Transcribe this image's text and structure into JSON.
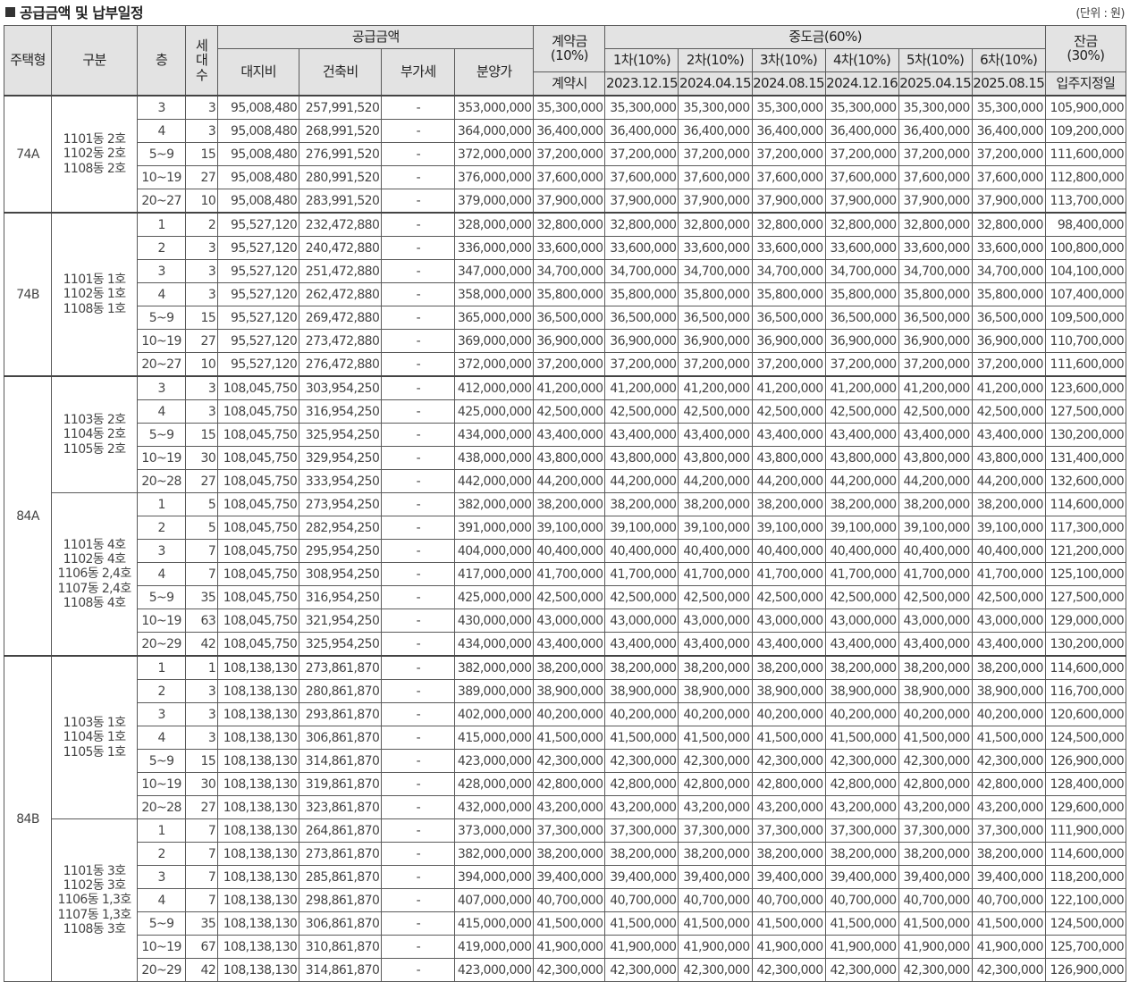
{
  "title": "공급금액 및 납부일정",
  "unit": "(단위 : 원)",
  "headers": {
    "type": "주택형",
    "group": "구분",
    "floor": "층",
    "units": "세\n대\n수",
    "supply": "공급금액",
    "land": "대지비",
    "build": "건축비",
    "vat": "부가세",
    "price": "분양가",
    "deposit": "계약금\n(10%)",
    "deposit_when": "계약시",
    "middle": "중도금(60%)",
    "mid_labels": [
      "1차(10%)",
      "2차(10%)",
      "3차(10%)",
      "4차(10%)",
      "5차(10%)",
      "6차(10%)"
    ],
    "mid_dates": [
      "2023.12.15",
      "2024.04.15",
      "2024.08.15",
      "2024.12.16",
      "2025.04.15",
      "2025.08.15"
    ],
    "balance": "잔금\n(30%)",
    "balance_when": "입주지정일"
  },
  "types": [
    {
      "name": "74A",
      "groups": [
        {
          "label": "1101동 2호\n1102동 2호\n1108동 2호",
          "land": "95,008,480",
          "rows": [
            [
              "3",
              "3",
              "257,991,520",
              "353,000,000",
              "35,300,000",
              "105,900,000"
            ],
            [
              "4",
              "3",
              "268,991,520",
              "364,000,000",
              "36,400,000",
              "109,200,000"
            ],
            [
              "5~9",
              "15",
              "276,991,520",
              "372,000,000",
              "37,200,000",
              "111,600,000"
            ],
            [
              "10~19",
              "27",
              "280,991,520",
              "376,000,000",
              "37,600,000",
              "112,800,000"
            ],
            [
              "20~27",
              "10",
              "283,991,520",
              "379,000,000",
              "37,900,000",
              "113,700,000"
            ]
          ]
        }
      ]
    },
    {
      "name": "74B",
      "groups": [
        {
          "label": "1101동 1호\n1102동 1호\n1108동 1호",
          "land": "95,527,120",
          "rows": [
            [
              "1",
              "2",
              "232,472,880",
              "328,000,000",
              "32,800,000",
              "98,400,000"
            ],
            [
              "2",
              "3",
              "240,472,880",
              "336,000,000",
              "33,600,000",
              "100,800,000"
            ],
            [
              "3",
              "3",
              "251,472,880",
              "347,000,000",
              "34,700,000",
              "104,100,000"
            ],
            [
              "4",
              "3",
              "262,472,880",
              "358,000,000",
              "35,800,000",
              "107,400,000"
            ],
            [
              "5~9",
              "15",
              "269,472,880",
              "365,000,000",
              "36,500,000",
              "109,500,000"
            ],
            [
              "10~19",
              "27",
              "273,472,880",
              "369,000,000",
              "36,900,000",
              "110,700,000"
            ],
            [
              "20~27",
              "10",
              "276,472,880",
              "372,000,000",
              "37,200,000",
              "111,600,000"
            ]
          ]
        }
      ]
    },
    {
      "name": "84A",
      "groups": [
        {
          "label": "1103동 2호\n1104동 2호\n1105동 2호",
          "land": "108,045,750",
          "rows": [
            [
              "3",
              "3",
              "303,954,250",
              "412,000,000",
              "41,200,000",
              "123,600,000"
            ],
            [
              "4",
              "3",
              "316,954,250",
              "425,000,000",
              "42,500,000",
              "127,500,000"
            ],
            [
              "5~9",
              "15",
              "325,954,250",
              "434,000,000",
              "43,400,000",
              "130,200,000"
            ],
            [
              "10~19",
              "30",
              "329,954,250",
              "438,000,000",
              "43,800,000",
              "131,400,000"
            ],
            [
              "20~28",
              "27",
              "333,954,250",
              "442,000,000",
              "44,200,000",
              "132,600,000"
            ]
          ]
        },
        {
          "label": "1101동 4호\n1102동 4호\n1106동 2,4호\n1107동 2,4호\n1108동 4호",
          "land": "108,045,750",
          "rows": [
            [
              "1",
              "5",
              "273,954,250",
              "382,000,000",
              "38,200,000",
              "114,600,000"
            ],
            [
              "2",
              "5",
              "282,954,250",
              "391,000,000",
              "39,100,000",
              "117,300,000"
            ],
            [
              "3",
              "7",
              "295,954,250",
              "404,000,000",
              "40,400,000",
              "121,200,000"
            ],
            [
              "4",
              "7",
              "308,954,250",
              "417,000,000",
              "41,700,000",
              "125,100,000"
            ],
            [
              "5~9",
              "35",
              "316,954,250",
              "425,000,000",
              "42,500,000",
              "127,500,000"
            ],
            [
              "10~19",
              "63",
              "321,954,250",
              "430,000,000",
              "43,000,000",
              "129,000,000"
            ],
            [
              "20~29",
              "42",
              "325,954,250",
              "434,000,000",
              "43,400,000",
              "130,200,000"
            ]
          ]
        }
      ]
    },
    {
      "name": "84B",
      "groups": [
        {
          "label": "1103동 1호\n1104동 1호\n1105동 1호",
          "land": "108,138,130",
          "rows": [
            [
              "1",
              "1",
              "273,861,870",
              "382,000,000",
              "38,200,000",
              "114,600,000"
            ],
            [
              "2",
              "3",
              "280,861,870",
              "389,000,000",
              "38,900,000",
              "116,700,000"
            ],
            [
              "3",
              "3",
              "293,861,870",
              "402,000,000",
              "40,200,000",
              "120,600,000"
            ],
            [
              "4",
              "3",
              "306,861,870",
              "415,000,000",
              "41,500,000",
              "124,500,000"
            ],
            [
              "5~9",
              "15",
              "314,861,870",
              "423,000,000",
              "42,300,000",
              "126,900,000"
            ],
            [
              "10~19",
              "30",
              "319,861,870",
              "428,000,000",
              "42,800,000",
              "128,400,000"
            ],
            [
              "20~28",
              "27",
              "323,861,870",
              "432,000,000",
              "43,200,000",
              "129,600,000"
            ]
          ]
        },
        {
          "label": "1101동 3호\n1102동 3호\n1106동 1,3호\n1107동 1,3호\n1108동 3호",
          "land": "108,138,130",
          "rows": [
            [
              "1",
              "7",
              "264,861,870",
              "373,000,000",
              "37,300,000",
              "111,900,000"
            ],
            [
              "2",
              "7",
              "273,861,870",
              "382,000,000",
              "38,200,000",
              "114,600,000"
            ],
            [
              "3",
              "7",
              "285,861,870",
              "394,000,000",
              "39,400,000",
              "118,200,000"
            ],
            [
              "4",
              "7",
              "298,861,870",
              "407,000,000",
              "40,700,000",
              "122,100,000"
            ],
            [
              "5~9",
              "35",
              "306,861,870",
              "415,000,000",
              "41,500,000",
              "124,500,000"
            ],
            [
              "10~19",
              "67",
              "310,861,870",
              "419,000,000",
              "41,900,000",
              "125,700,000"
            ],
            [
              "20~29",
              "42",
              "314,861,870",
              "423,000,000",
              "42,300,000",
              "126,900,000"
            ]
          ]
        }
      ]
    }
  ],
  "vat_value": "-"
}
